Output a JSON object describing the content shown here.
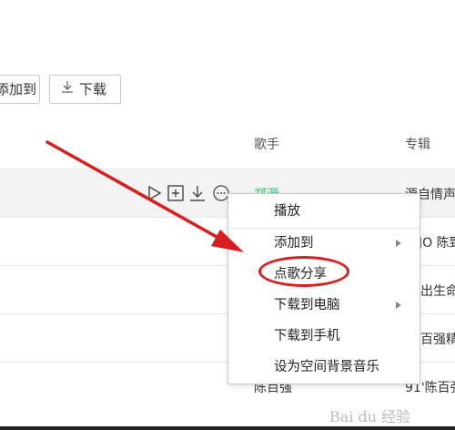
{
  "toolbar": {
    "add_label": "添加到",
    "download_label": "下载"
  },
  "table": {
    "headers": {
      "artist": "歌手",
      "album": "专辑"
    },
    "rows": [
      {
        "artist": "郑源",
        "album": "源自情声"
      },
      {
        "album": "JO 陈致"
      },
      {
        "album": "出生命"
      },
      {
        "album": "百强精"
      },
      {
        "artist": "陈百强",
        "album": "91'陈百强"
      }
    ]
  },
  "context_menu": {
    "items": [
      "播放",
      "添加到",
      "点歌分享",
      "下载到电脑",
      "下载到手机",
      "设为空间背景音乐"
    ]
  },
  "watermark": "Bai du 经验",
  "colors": {
    "annotation": "#d81e1e",
    "accent_green": "#31c27c"
  }
}
